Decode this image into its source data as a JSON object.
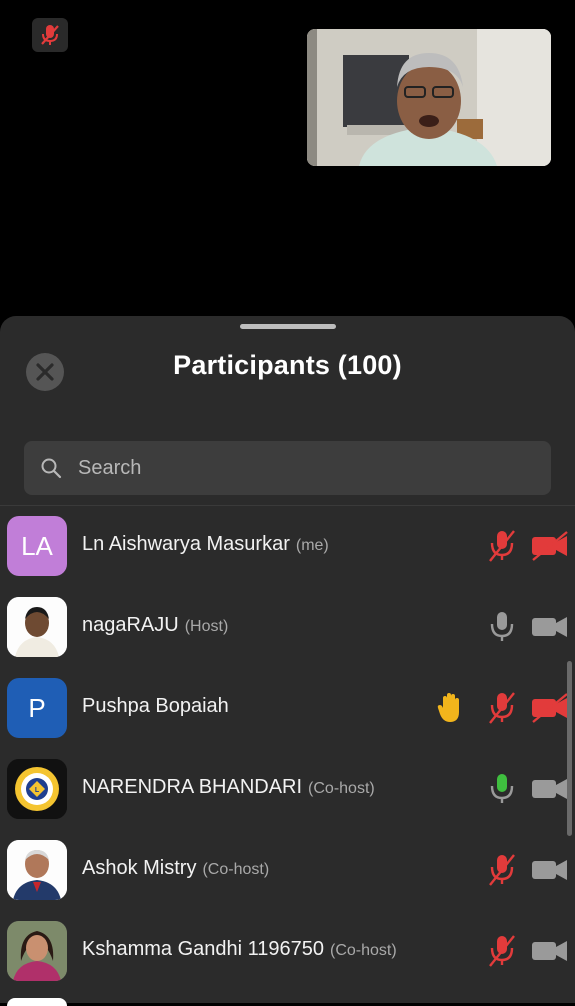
{
  "colors": {
    "background": "#000000",
    "sheet": "#2b2b2b",
    "muted_red": "#e23b3b",
    "active_green": "#3fbf3f",
    "icon_gray": "#9a9a9a",
    "hand_yellow": "#f2b51c"
  },
  "meeting": {
    "self_mute_icon": "mic-muted-icon"
  },
  "panel": {
    "title": "Participants (100)",
    "close_icon": "close-icon"
  },
  "search": {
    "placeholder": "Search",
    "value": ""
  },
  "participants": [
    {
      "initials": "LA",
      "avatar_color": "#c17ed8",
      "name": "Ln Aishwarya Masurkar",
      "role": "(me)",
      "mic": "muted",
      "video": "off",
      "hand": false
    },
    {
      "initials": "",
      "avatar_color": "#ffffff",
      "name": "nagaRAJU",
      "role": "(Host)",
      "mic": "on",
      "video": "on",
      "hand": false
    },
    {
      "initials": "P",
      "avatar_color": "#1f5eb5",
      "name": "Pushpa Bopaiah",
      "role": "",
      "mic": "muted",
      "video": "off",
      "hand": true
    },
    {
      "initials": "",
      "avatar_color": "#111111",
      "name": "NARENDRA BHANDARI",
      "role": "(Co-host)",
      "mic": "talking",
      "video": "on",
      "hand": false
    },
    {
      "initials": "",
      "avatar_color": "#ffffff",
      "name": "Ashok Mistry",
      "role": "(Co-host)",
      "mic": "muted",
      "video": "on",
      "hand": false
    },
    {
      "initials": "",
      "avatar_color": "#6b6b6b",
      "name": "Kshamma Gandhi 1196750",
      "role": "(Co-host)",
      "mic": "muted",
      "video": "on",
      "hand": false
    }
  ]
}
